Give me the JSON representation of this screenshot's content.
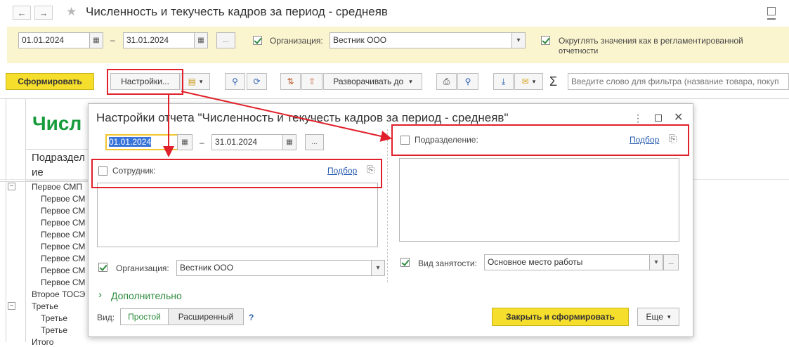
{
  "window": {
    "title": "Численность и текучесть кадров за период - среднеяв",
    "back_icon": "arrow-left-icon",
    "forward_icon": "arrow-right-icon",
    "favorite_icon": "star-icon"
  },
  "params": {
    "date_from": "01.01.2024",
    "date_sep": "–",
    "date_to": "31.01.2024",
    "ellipsis": "...",
    "org_label": "Организация:",
    "org_value": "Вестник ООО",
    "round_label_1": "Округлять значения как в регламентированной",
    "round_label_2": "отчетности"
  },
  "toolbar": {
    "generate": "Сформировать",
    "settings": "Настройки...",
    "expand_to": "Разворачивать до",
    "sigma": "Σ",
    "search_placeholder": "Введите слово для фильтра (название товара, покуп"
  },
  "report": {
    "title_fragment": "Числ",
    "col_header_1": "Подраздел",
    "col_header_2": "ие",
    "rows": [
      "Первое СМП",
      "Первое СМ",
      "Первое СМ",
      "Первое СМ",
      "Первое СМ",
      "Первое СМ",
      "Первое СМ",
      "Первое СМ",
      "Первое СМ",
      "Второе ТОСЭ",
      "Третье",
      "Третье",
      "Третье",
      "Итого"
    ]
  },
  "dialog": {
    "title": "Настройки отчета \"Численность и текучесть кадров за период - среднеяв\"",
    "date_from": "01.01.2024",
    "date_sep": "–",
    "date_to": "31.01.2024",
    "ellipsis": "...",
    "employee_label": "Сотрудник:",
    "pick_link": "Подбор",
    "department_label": "Подразделение:",
    "org_label": "Организация:",
    "org_value": "Вестник ООО",
    "employment_label": "Вид занятости:",
    "employment_value": "Основное место работы",
    "more_label": "Дополнительно",
    "view_label": "Вид:",
    "view_simple": "Простой",
    "view_extended": "Расширенный",
    "help": "?",
    "close_generate": "Закрыть и сформировать",
    "more_button": "Еще"
  },
  "colors": {
    "accent_yellow": "#f6de2c",
    "panel_yellow": "#fbf5cf",
    "annotation_red": "#e0202a",
    "link_blue": "#2a5eb0",
    "green": "#2e8b3e"
  }
}
